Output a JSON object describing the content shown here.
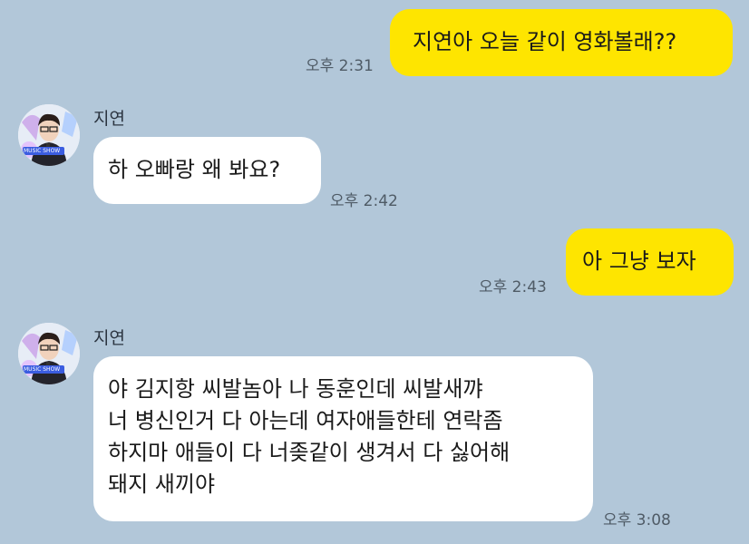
{
  "messages": [
    {
      "from": "me",
      "text": "지연아 오늘 같이 영화볼래??",
      "time": "오후 2:31"
    },
    {
      "from": "other",
      "sender": "지연",
      "text": "하 오빠랑 왜 봐요?",
      "time": "오후 2:42"
    },
    {
      "from": "me",
      "text": "아 그냥 보자",
      "time": "오후 2:43"
    },
    {
      "from": "other",
      "sender": "지연",
      "lines": [
        "야 김지항 씨발놈아 나 동훈인데 씨발새꺄",
        "너 병신인거 다 아는데 여자애들한테 연락좀",
        "하지마 애들이 다 너좆같이 생겨서 다 싫어해",
        "돼지 새끼야"
      ],
      "time": "오후 3:08"
    }
  ],
  "avatar": {
    "banner_text": "MUSIC SHOW"
  },
  "colors": {
    "background": "#b2c7d9",
    "my_bubble": "#fee500",
    "other_bubble": "#ffffff"
  }
}
